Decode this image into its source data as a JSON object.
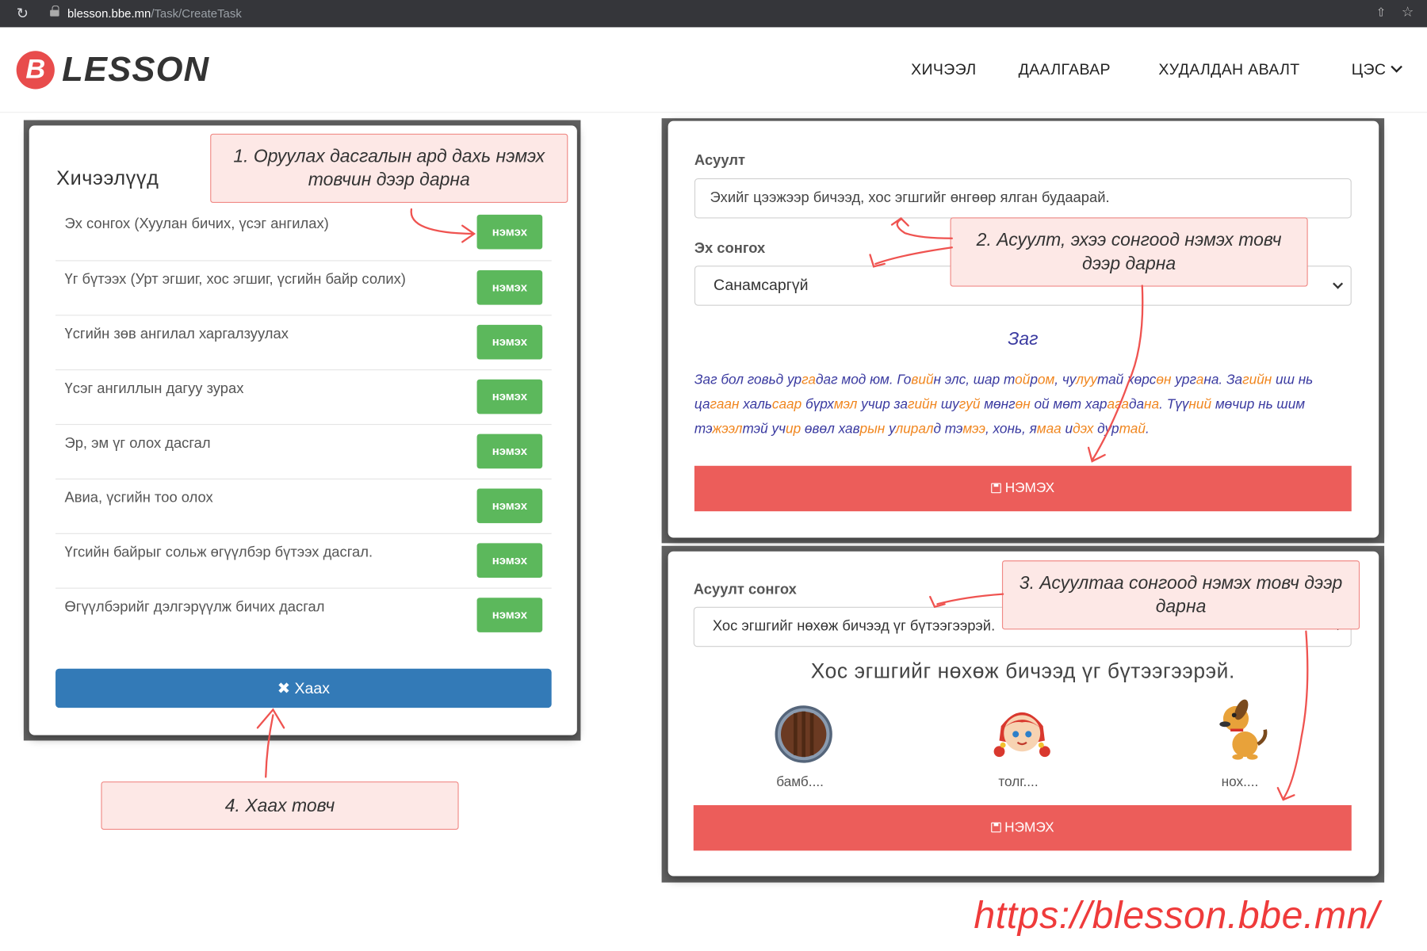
{
  "browser": {
    "url_host": "blesson.bbe.mn",
    "url_path": "/Task/CreateTask"
  },
  "header": {
    "logo_letter": "B",
    "logo_text": "LESSON",
    "nav": [
      "ХИЧЭЭЛ",
      "ДААЛГАВАР",
      "ХУДАЛДАН АВАЛТ",
      "ЦЭС"
    ]
  },
  "lessons_panel": {
    "title": "Хичээлүүд",
    "add_label": "нэмэх",
    "items": [
      "Эх сонгох (Хуулан бичих, үсэг ангилах)",
      "Үг бүтээх (Урт эгшиг, хос эгшиг, үсгийн байр солих)",
      "Үсгийн зөв ангилал харгалзуулах",
      "Үсэг ангиллын дагуу зурах",
      "Эр, эм үг олох дасгал",
      "Авиа, үсгийн тоо олох",
      "Үгсийн байрыг сольж өгүүлбэр бүтээх дасгал.",
      "Өгүүлбэрийг дэлгэрүүлж бичих дасгал"
    ],
    "close_label": "Хаах",
    "close_icon": "times-icon"
  },
  "question_panel": {
    "question_label": "Асуулт",
    "question_value": "Эхийг цээжээр бичээд, хос эгшгийг өнгөөр ялган будаарай.",
    "source_label": "Эх сонгох",
    "source_value": "Санамсаргүй",
    "story_title": "Заг",
    "story_segments": [
      {
        "t": "Заг бол говьд ур",
        "c": "b"
      },
      {
        "t": "га",
        "c": "o"
      },
      {
        "t": "даг мод юм. Го",
        "c": "b"
      },
      {
        "t": "вий",
        "c": "o"
      },
      {
        "t": "н элс, шар т",
        "c": "b"
      },
      {
        "t": "ой",
        "c": "o"
      },
      {
        "t": "р",
        "c": "b"
      },
      {
        "t": "ом",
        "c": "o"
      },
      {
        "t": ", чу",
        "c": "b"
      },
      {
        "t": "луу",
        "c": "o"
      },
      {
        "t": "тай хөрс",
        "c": "b"
      },
      {
        "t": "өн",
        "c": "o"
      },
      {
        "t": " ург",
        "c": "b"
      },
      {
        "t": "а",
        "c": "o"
      },
      {
        "t": "на. За",
        "c": "b"
      },
      {
        "t": "гийн",
        "c": "o"
      },
      {
        "t": " иш нь ца",
        "c": "b"
      },
      {
        "t": "гаан",
        "c": "o"
      },
      {
        "t": " халь",
        "c": "b"
      },
      {
        "t": "саар",
        "c": "o"
      },
      {
        "t": " бүрх",
        "c": "b"
      },
      {
        "t": "мэл",
        "c": "o"
      },
      {
        "t": " учир за",
        "c": "b"
      },
      {
        "t": "гийн",
        "c": "o"
      },
      {
        "t": " шу",
        "c": "b"
      },
      {
        "t": "гуй",
        "c": "o"
      },
      {
        "t": " мөнг",
        "c": "b"
      },
      {
        "t": "өн",
        "c": "o"
      },
      {
        "t": " ой мөт хар",
        "c": "b"
      },
      {
        "t": "ага",
        "c": "o"
      },
      {
        "t": "да",
        "c": "b"
      },
      {
        "t": "на",
        "c": "o"
      },
      {
        "t": ". Түү",
        "c": "b"
      },
      {
        "t": "ний",
        "c": "o"
      },
      {
        "t": " мөчир нь шим тэ",
        "c": "b"
      },
      {
        "t": "жээл",
        "c": "o"
      },
      {
        "t": "тэй уч",
        "c": "b"
      },
      {
        "t": "ир",
        "c": "o"
      },
      {
        "t": " өвөл хав",
        "c": "b"
      },
      {
        "t": "рын",
        "c": "o"
      },
      {
        "t": " у",
        "c": "b"
      },
      {
        "t": "лирал",
        "c": "o"
      },
      {
        "t": "д тэ",
        "c": "b"
      },
      {
        "t": "мээ",
        "c": "o"
      },
      {
        "t": ", хонь, я",
        "c": "b"
      },
      {
        "t": "маа",
        "c": "o"
      },
      {
        "t": " и",
        "c": "b"
      },
      {
        "t": "дэх",
        "c": "o"
      },
      {
        "t": " дур",
        "c": "b"
      },
      {
        "t": "тай",
        "c": "o"
      },
      {
        "t": ".",
        "c": "b"
      }
    ],
    "add_label": "НЭМЭХ"
  },
  "select_panel": {
    "label": "Асуулт сонгох",
    "select_value": "Хос эгшгийг нөхөж бичээд үг бүтээгээрэй.",
    "heading": "Хос эгшгийг нөхөж бичээд үг бүтээгээрэй.",
    "pictures": [
      {
        "icon": "drum-icon",
        "label": "бамб...."
      },
      {
        "icon": "girl-head-icon",
        "label": "толг...."
      },
      {
        "icon": "dog-icon",
        "label": "нох...."
      }
    ],
    "add_label": "НЭМЭХ"
  },
  "callouts": [
    "1. Оруулах дасгалын ард дахь нэмэх товчин дээр дарна",
    "2. Асуулт, эхээ сонгоод нэмэх товч дээр дарна",
    "3. Асуултаа сонгоод нэмэх товч дээр дарна",
    "4. Хаах товч"
  ],
  "watermark": "https://blesson.bbe.mn/",
  "colors": {
    "green": "#5cb85c",
    "blue": "#337ab7",
    "red": "#ec5d5a",
    "callout_bg": "#fde8e6",
    "callout_border": "#f08a86",
    "story_blue": "#3a3aa0",
    "story_orange": "#f0861f"
  }
}
